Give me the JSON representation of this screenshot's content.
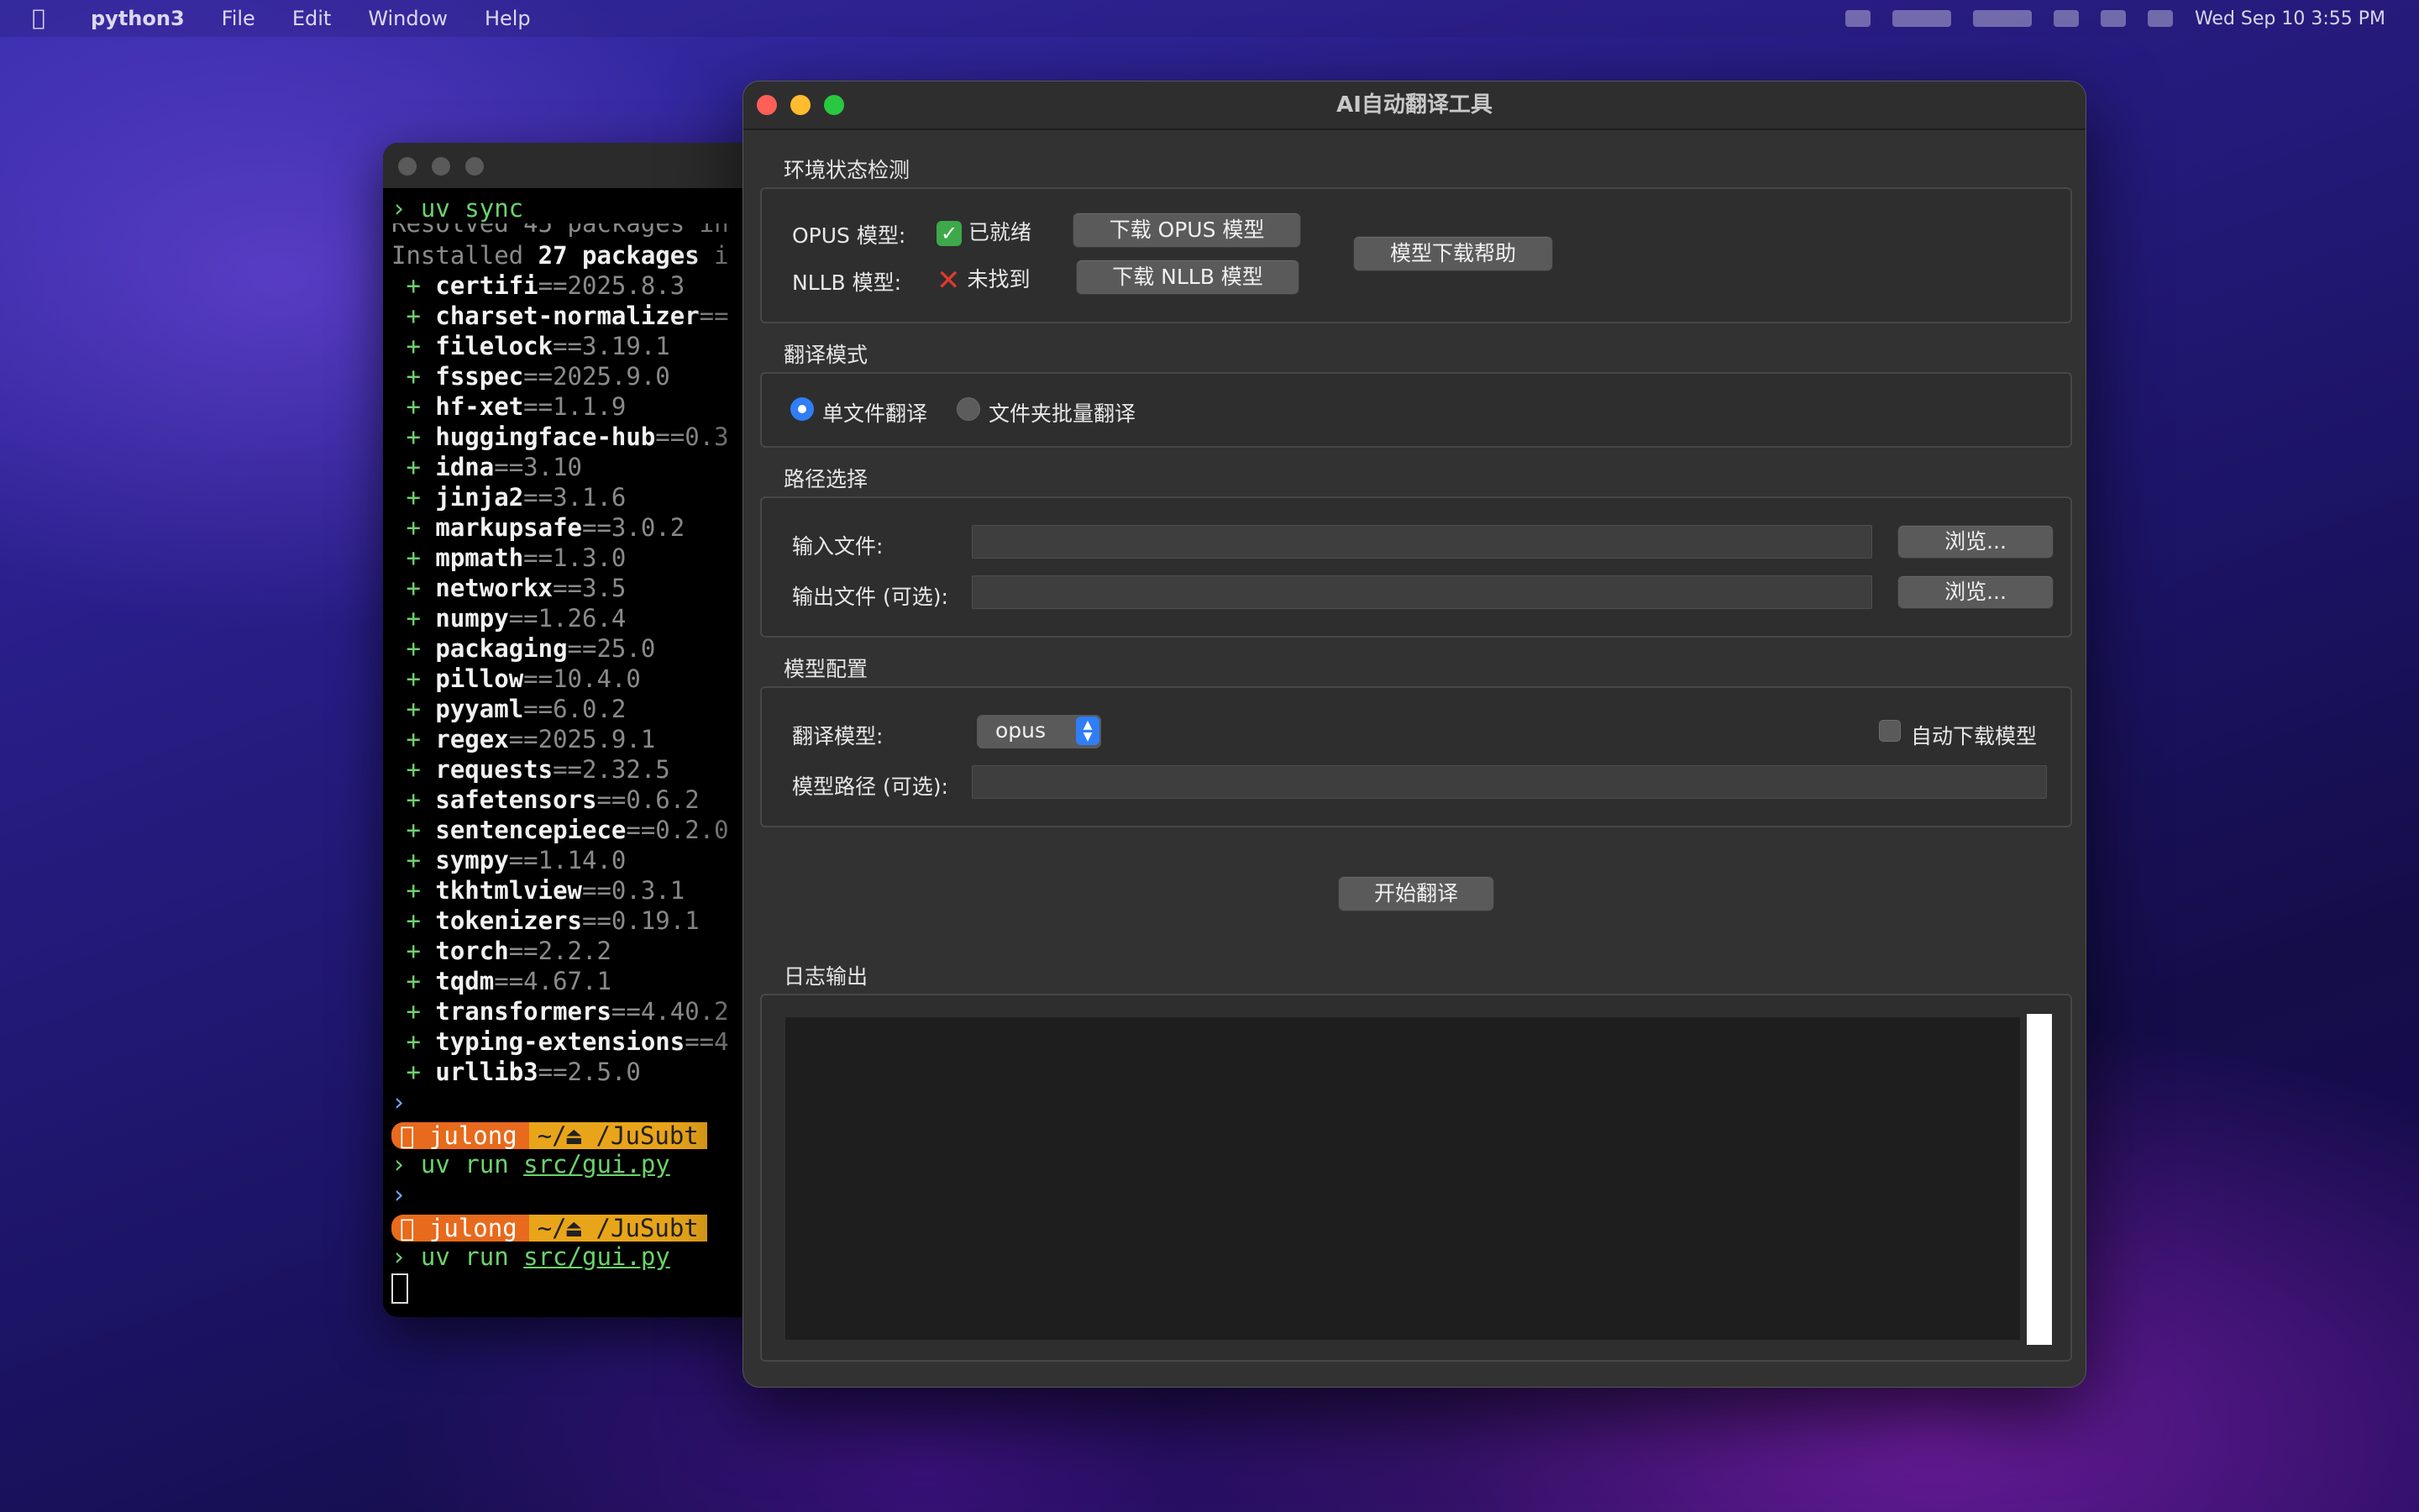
{
  "menubar": {
    "app_name": "python3",
    "items": [
      "File",
      "Edit",
      "Window",
      "Help"
    ],
    "datetime": "Wed Sep 10 3:55 PM"
  },
  "terminal": {
    "lines": [
      {
        "type": "cmd",
        "text": "uv sync"
      },
      {
        "type": "partial",
        "text": "Resolved 45 packages in"
      },
      {
        "type": "installed",
        "prefix": "Installed ",
        "count": "27 packages",
        "suffix": " i"
      }
    ],
    "packages": [
      {
        "name": "certifi",
        "version": "==2025.8.3"
      },
      {
        "name": "charset-normalizer",
        "version": "=="
      },
      {
        "name": "filelock",
        "version": "==3.19.1"
      },
      {
        "name": "fsspec",
        "version": "==2025.9.0"
      },
      {
        "name": "hf-xet",
        "version": "==1.1.9"
      },
      {
        "name": "huggingface-hub",
        "version": "==0.3"
      },
      {
        "name": "idna",
        "version": "==3.10"
      },
      {
        "name": "jinja2",
        "version": "==3.1.6"
      },
      {
        "name": "markupsafe",
        "version": "==3.0.2"
      },
      {
        "name": "mpmath",
        "version": "==1.3.0"
      },
      {
        "name": "networkx",
        "version": "==3.5"
      },
      {
        "name": "numpy",
        "version": "==1.26.4"
      },
      {
        "name": "packaging",
        "version": "==25.0"
      },
      {
        "name": "pillow",
        "version": "==10.4.0"
      },
      {
        "name": "pyyaml",
        "version": "==6.0.2"
      },
      {
        "name": "regex",
        "version": "==2025.9.1"
      },
      {
        "name": "requests",
        "version": "==2.32.5"
      },
      {
        "name": "safetensors",
        "version": "==0.6.2"
      },
      {
        "name": "sentencepiece",
        "version": "==0.2.0"
      },
      {
        "name": "sympy",
        "version": "==1.14.0"
      },
      {
        "name": "tkhtmlview",
        "version": "==0.3.1"
      },
      {
        "name": "tokenizers",
        "version": "==0.19.1"
      },
      {
        "name": "torch",
        "version": "==2.2.2"
      },
      {
        "name": "tqdm",
        "version": "==4.67.1"
      },
      {
        "name": "transformers",
        "version": "==4.40.2"
      },
      {
        "name": "typing-extensions",
        "version": "==4"
      },
      {
        "name": "urllib3",
        "version": "==2.5.0"
      }
    ],
    "prompt_user": "julong",
    "prompt_path": "~/⏏ /JuSubt",
    "run_cmd_prefix": "uv run ",
    "run_cmd_file": "src/gui.py"
  },
  "app": {
    "title": "AI自动翻译工具",
    "env_section": {
      "title": "环境状态检测",
      "opus_label": "OPUS 模型:",
      "opus_status": "已就绪",
      "opus_button": "下载 OPUS 模型",
      "nllb_label": "NLLB 模型:",
      "nllb_status": "未找到",
      "nllb_button": "下载 NLLB 模型",
      "help_button": "模型下载帮助"
    },
    "mode_section": {
      "title": "翻译模式",
      "option_single": "单文件翻译",
      "option_batch": "文件夹批量翻译",
      "selected": "单文件翻译"
    },
    "path_section": {
      "title": "路径选择",
      "input_label": "输入文件:",
      "input_value": "",
      "input_browse": "浏览...",
      "output_label": "输出文件 (可选):",
      "output_value": "",
      "output_browse": "浏览..."
    },
    "model_section": {
      "title": "模型配置",
      "model_label": "翻译模型:",
      "model_value": "opus",
      "auto_download_label": "自动下载模型",
      "auto_download_checked": false,
      "path_label": "模型路径 (可选):",
      "path_value": ""
    },
    "start_button": "开始翻译",
    "log_section": {
      "title": "日志输出",
      "content": ""
    }
  }
}
